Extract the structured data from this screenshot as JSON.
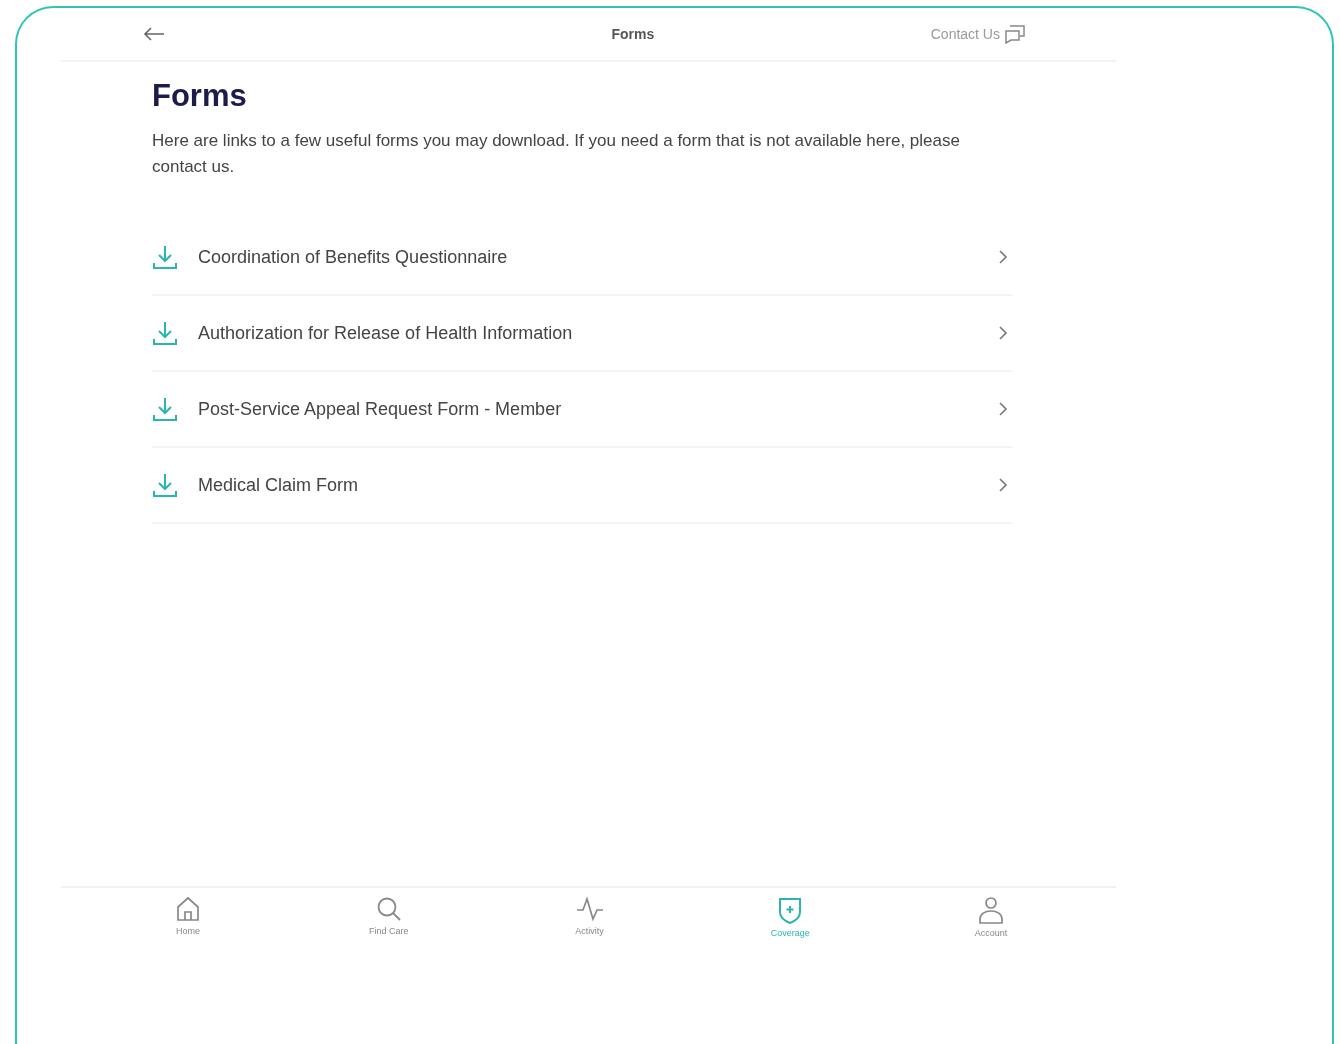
{
  "header": {
    "title": "Forms",
    "contact": "Contact Us"
  },
  "page": {
    "heading": "Forms",
    "intro": "Here are links to a few useful forms you may download. If you need a form that is not available here, please contact us."
  },
  "forms": [
    {
      "label": "Coordination of Benefits Questionnaire"
    },
    {
      "label": "Authorization for Release of Health Information"
    },
    {
      "label": "Post-Service Appeal Request Form - Member"
    },
    {
      "label": "Medical Claim Form"
    }
  ],
  "nav": [
    {
      "kind": "home",
      "label": "Home",
      "selected": false
    },
    {
      "kind": "search",
      "label": "Find Care",
      "selected": false
    },
    {
      "kind": "activity",
      "label": "Activity",
      "selected": false
    },
    {
      "kind": "coverage",
      "label": "Coverage",
      "selected": true
    },
    {
      "kind": "account",
      "label": "Account",
      "selected": false
    }
  ]
}
